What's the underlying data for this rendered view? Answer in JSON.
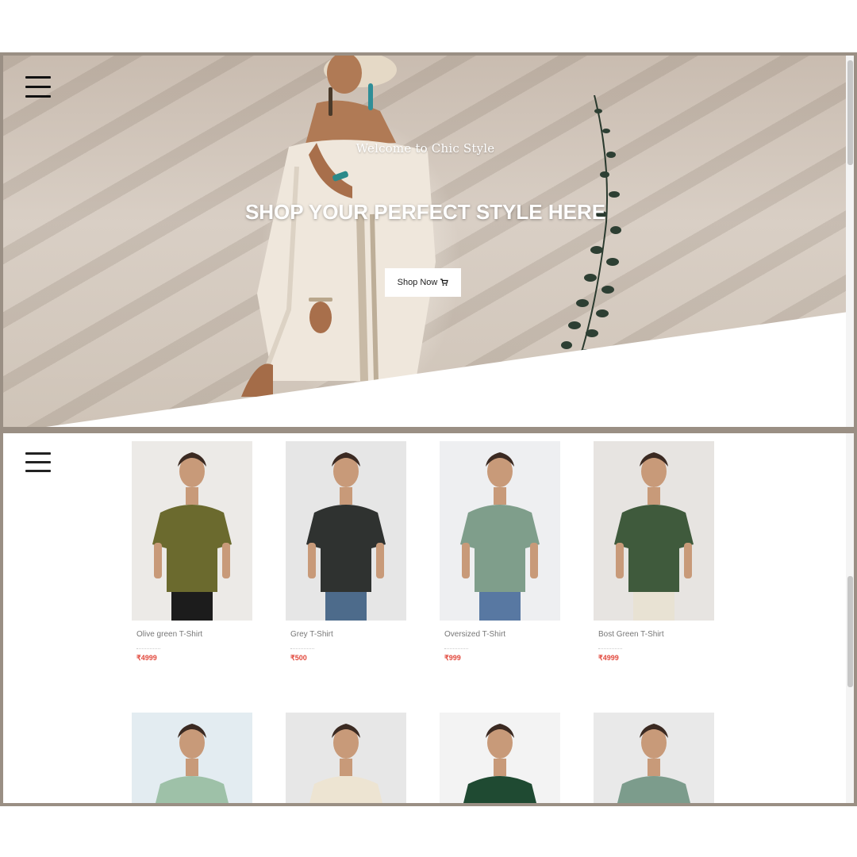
{
  "hero": {
    "welcome": "Welcome to Chic Style",
    "title": "SHOP YOUR PERFECT STYLE HERE",
    "cta_label": "Shop Now"
  },
  "products": [
    {
      "name": "Olive green T-Shirt",
      "price": "₹4999",
      "shirt": "#6b6a2e",
      "bg": "#eceae7",
      "pants": "#1c1c1c"
    },
    {
      "name": "Grey T-Shirt",
      "price": "₹500",
      "shirt": "#2f3230",
      "bg": "#e6e6e6",
      "pants": "#4d6b8b"
    },
    {
      "name": "Oversized T-Shirt",
      "price": "₹999",
      "shirt": "#7f9e8b",
      "bg": "#eeeff1",
      "pants": "#5878a2"
    },
    {
      "name": "Bost Green T-Shirt",
      "price": "₹4999",
      "shirt": "#3f5a3c",
      "bg": "#e7e4e1",
      "pants": "#e8e2d3"
    },
    {
      "name": "",
      "price": "",
      "shirt": "#9ec1a8",
      "bg": "#e3ecf1",
      "pants": ""
    },
    {
      "name": "",
      "price": "",
      "shirt": "#ede4d2",
      "bg": "#e7e7e7",
      "pants": ""
    },
    {
      "name": "",
      "price": "",
      "shirt": "#1f4a32",
      "bg": "#f3f3f3",
      "pants": ""
    },
    {
      "name": "",
      "price": "",
      "shirt": "#7c9c8c",
      "bg": "#e9e9e9",
      "pants": ""
    }
  ]
}
